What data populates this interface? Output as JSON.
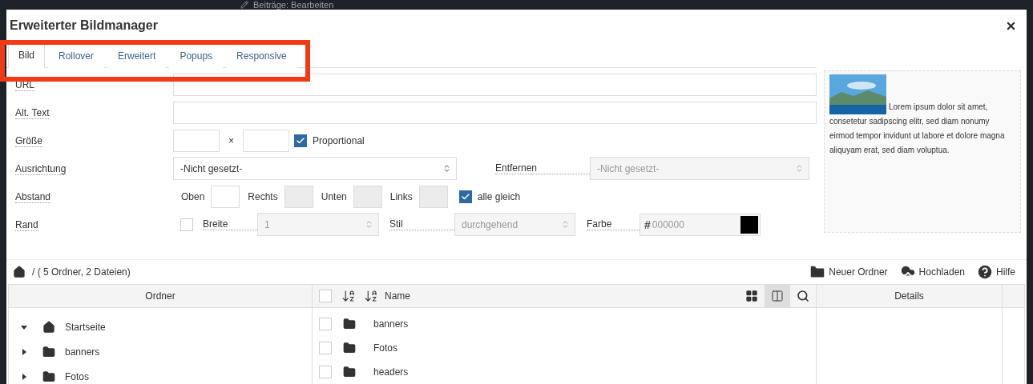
{
  "background": {
    "title": "Beiträge: Bearbeiten"
  },
  "dialog": {
    "title": "Erweiterter Bildmanager"
  },
  "tabs": [
    {
      "label": "Bild",
      "selected": true
    },
    {
      "label": "Rollover",
      "selected": false
    },
    {
      "label": "Erweitert",
      "selected": false
    },
    {
      "label": "Popups",
      "selected": false
    },
    {
      "label": "Responsive",
      "selected": false
    }
  ],
  "form": {
    "url": {
      "label": "URL"
    },
    "alt": {
      "label": "Alt. Text"
    },
    "size": {
      "label": "Größe",
      "separator": "×",
      "proportional": {
        "label": "Proportional",
        "checked": true
      }
    },
    "alignment": {
      "label": "Ausrichtung",
      "value": "-Nicht gesetzt-",
      "remove_label": "Entfernen",
      "remove_value": "-Nicht gesetzt-",
      "remove_disabled": true
    },
    "spacing": {
      "label": "Abstand",
      "sides": [
        {
          "label": "Oben",
          "disabled": false
        },
        {
          "label": "Rechts",
          "disabled": true
        },
        {
          "label": "Unten",
          "disabled": true
        },
        {
          "label": "Links",
          "disabled": true
        }
      ],
      "equal": {
        "label": "alle gleich",
        "checked": true
      }
    },
    "border": {
      "label": "Rand",
      "checked": false,
      "width_label": "Breite",
      "width_value": "1",
      "style_label": "Stil",
      "style_value": "durchgehend",
      "color_label": "Farbe",
      "hash": "#",
      "color_value": "000000",
      "color": "#000000"
    }
  },
  "preview": {
    "text": "Lorem ipsum dolor sit amet, consetetur sadipscing elitr, sed diam nonumy eirmod tempor invidunt ut labore et dolore magna aliquyam erat, sed diam voluptua."
  },
  "file_manager": {
    "breadcrumb": "/ ( 5 Ordner, 2 Dateien)",
    "actions": [
      {
        "kind": "new-folder",
        "label": "Neuer Ordner"
      },
      {
        "kind": "upload",
        "label": "Hochladen"
      },
      {
        "kind": "help",
        "label": "Hilfe"
      }
    ],
    "columns": {
      "folders": "Ordner",
      "name": "Name",
      "details": "Details"
    },
    "view_modes": [
      {
        "kind": "grid",
        "selected": false
      },
      {
        "kind": "columns",
        "selected": true
      }
    ],
    "select_all": {
      "checked": false
    },
    "tree": [
      {
        "label": "Startseite",
        "kind": "home",
        "expanded": true,
        "children": [
          {
            "label": "banners",
            "kind": "folder",
            "expanded": false
          },
          {
            "label": "Fotos",
            "kind": "folder",
            "expanded": false
          }
        ]
      }
    ],
    "files": [
      {
        "name": "banners",
        "checked": false
      },
      {
        "name": "Fotos",
        "checked": false
      },
      {
        "name": "headers",
        "checked": false
      }
    ]
  }
}
